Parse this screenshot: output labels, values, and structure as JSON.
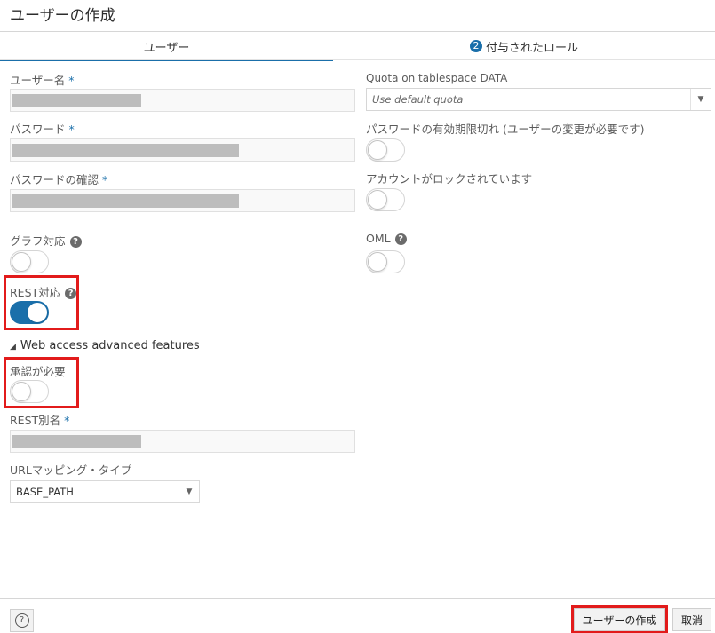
{
  "window": {
    "title": "ユーザーの作成"
  },
  "tabs": {
    "users": "ユーザー",
    "roles_badge": "2",
    "roles": "付与されたロール"
  },
  "form": {
    "username": {
      "label": "ユーザー名",
      "required": "*",
      "value_masked": true
    },
    "password": {
      "label": "パスワード",
      "required": "*"
    },
    "password_confirm": {
      "label": "パスワードの確認",
      "required": "*"
    },
    "quota": {
      "label": "Quota on tablespace DATA",
      "placeholder": "Use default quota"
    },
    "password_expired": {
      "label": "パスワードの有効期限切れ (ユーザーの変更が必要です)",
      "on": false
    },
    "account_locked": {
      "label": "アカウントがロックされています",
      "on": false
    },
    "graph": {
      "label": "グラフ対応",
      "help": "?",
      "on": false
    },
    "oml": {
      "label": "OML",
      "help": "?",
      "on": false
    },
    "rest": {
      "label": "REST対応",
      "help": "?",
      "on": true
    },
    "web_access": {
      "label": "Web access advanced features"
    },
    "auth_required": {
      "label": "承認が必要",
      "on": false
    },
    "rest_alias": {
      "label": "REST別名",
      "required": "*"
    },
    "url_mapping": {
      "label": "URLマッピング・タイプ",
      "value": "BASE_PATH"
    }
  },
  "footer": {
    "help": "?",
    "create": "ユーザーの作成",
    "cancel": "取消"
  },
  "colors": {
    "accent": "#1a6faa",
    "highlight": "#e21b1b"
  }
}
